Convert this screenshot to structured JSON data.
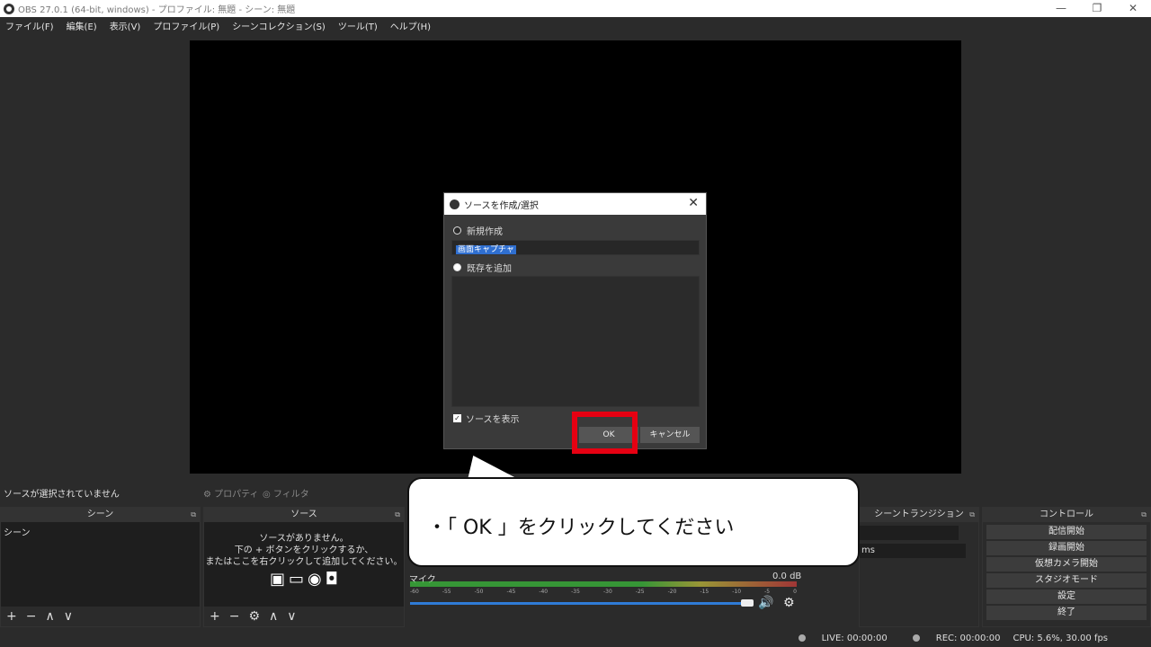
{
  "window": {
    "title": "OBS 27.0.1 (64-bit, windows) - プロファイル: 無題 - シーン: 無題",
    "minimize": "—",
    "restore": "❐",
    "close": "✕"
  },
  "menu": [
    "ファイル(F)",
    "編集(E)",
    "表示(V)",
    "プロファイル(P)",
    "シーンコレクション(S)",
    "ツール(T)",
    "ヘルプ(H)"
  ],
  "dialog": {
    "title": "ソースを作成/選択",
    "new_label": "新規作成",
    "name_value": "画面キャプチャ",
    "existing_label": "既存を追加",
    "show_source_label": "ソースを表示",
    "ok_label": "OK",
    "cancel_label": "キャンセル"
  },
  "source_status": {
    "no_selection": "ソースが選択されていません",
    "properties": "プロパティ",
    "filters": "フィルタ"
  },
  "scenes": {
    "header": "シーン",
    "items": [
      "シーン"
    ]
  },
  "sources": {
    "header": "ソース",
    "empty_line1": "ソースがありません。",
    "empty_line2": "下の + ボタンをクリックするか、",
    "empty_line3": "またはここを右クリックして追加してください。"
  },
  "mixer": {
    "track_name": "マイク",
    "level": "0.0 dB",
    "ticks": [
      "-60",
      "-55",
      "-50",
      "-45",
      "-40",
      "-35",
      "-30",
      "-25",
      "-20",
      "-15",
      "-10",
      "-5",
      "0"
    ]
  },
  "transitions": {
    "header": "シーントランジション",
    "duration_unit": "ms"
  },
  "controls": {
    "header": "コントロール",
    "buttons": [
      "配信開始",
      "録画開始",
      "仮想カメラ開始",
      "スタジオモード",
      "設定",
      "終了"
    ]
  },
  "callout": {
    "text": "・「 OK 」をクリックしてください"
  },
  "statusbar": {
    "live": "LIVE: 00:00:00",
    "rec": "REC: 00:00:00",
    "cpu": "CPU: 5.6%, 30.00 fps"
  }
}
